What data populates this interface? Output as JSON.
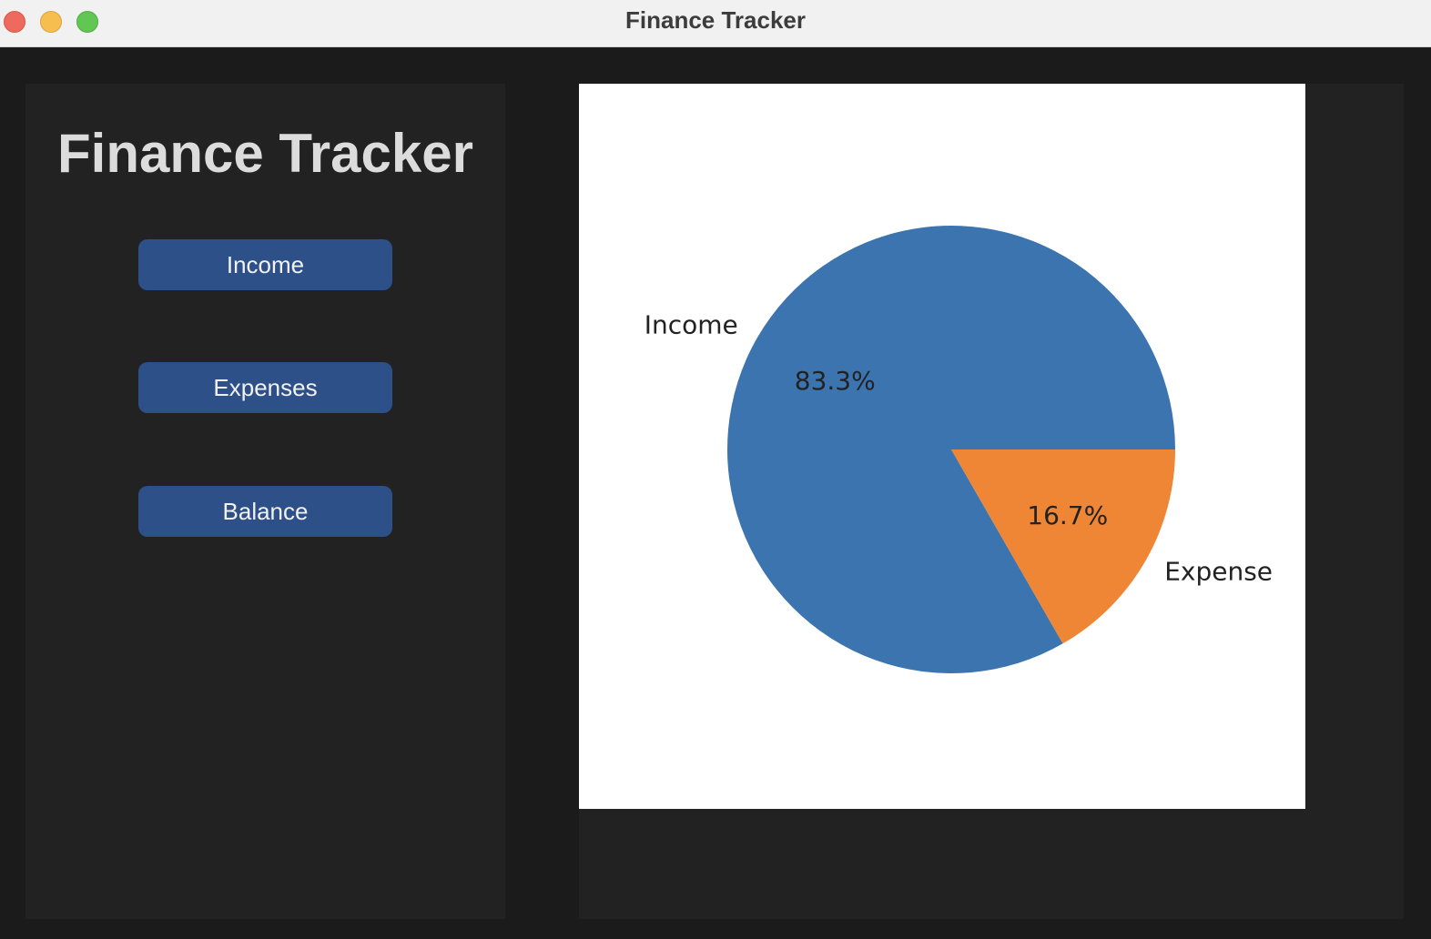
{
  "window": {
    "title": "Finance Tracker"
  },
  "sidebar": {
    "title": "Finance Tracker",
    "buttons": [
      {
        "label": "Income"
      },
      {
        "label": "Expenses"
      },
      {
        "label": "Balance"
      }
    ]
  },
  "colors": {
    "income": "#3b74ae",
    "expense": "#ef8636",
    "button": "#2d5088"
  },
  "chart_data": {
    "type": "pie",
    "categories": [
      "Income",
      "Expense"
    ],
    "values": [
      83.3,
      16.7
    ],
    "value_labels": [
      "83.3%",
      "16.7%"
    ],
    "colors": [
      "#3b74ae",
      "#ef8636"
    ],
    "title": "",
    "legend": "none"
  }
}
